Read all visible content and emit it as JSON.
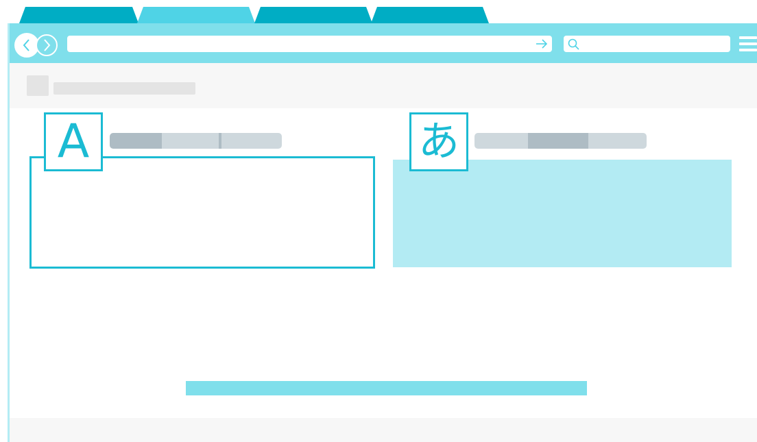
{
  "colors": {
    "accent_dark": "#00adc4",
    "accent_light": "#4fd3e6",
    "toolbar": "#7fdfeb",
    "outline": "#1bbbd3",
    "panel_fill": "#b3ebf3",
    "placeholder": "#e4e4e4",
    "pill": "#ced8dd",
    "pill_thumb": "#aebcc4"
  },
  "tabs": [
    {
      "label": "",
      "state": "inactive"
    },
    {
      "label": "",
      "state": "active"
    },
    {
      "label": "",
      "state": "inactive"
    },
    {
      "label": "",
      "state": "inactive"
    }
  ],
  "toolbar": {
    "back_icon": "chevron-left-icon",
    "forward_icon": "chevron-right-icon",
    "url_value": "",
    "go_icon": "arrow-right-icon",
    "search_value": "",
    "search_icon": "search-icon",
    "menu_icon": "hamburger-menu-icon"
  },
  "languages": {
    "source": {
      "glyph": "A"
    },
    "target": {
      "glyph": "あ"
    }
  }
}
